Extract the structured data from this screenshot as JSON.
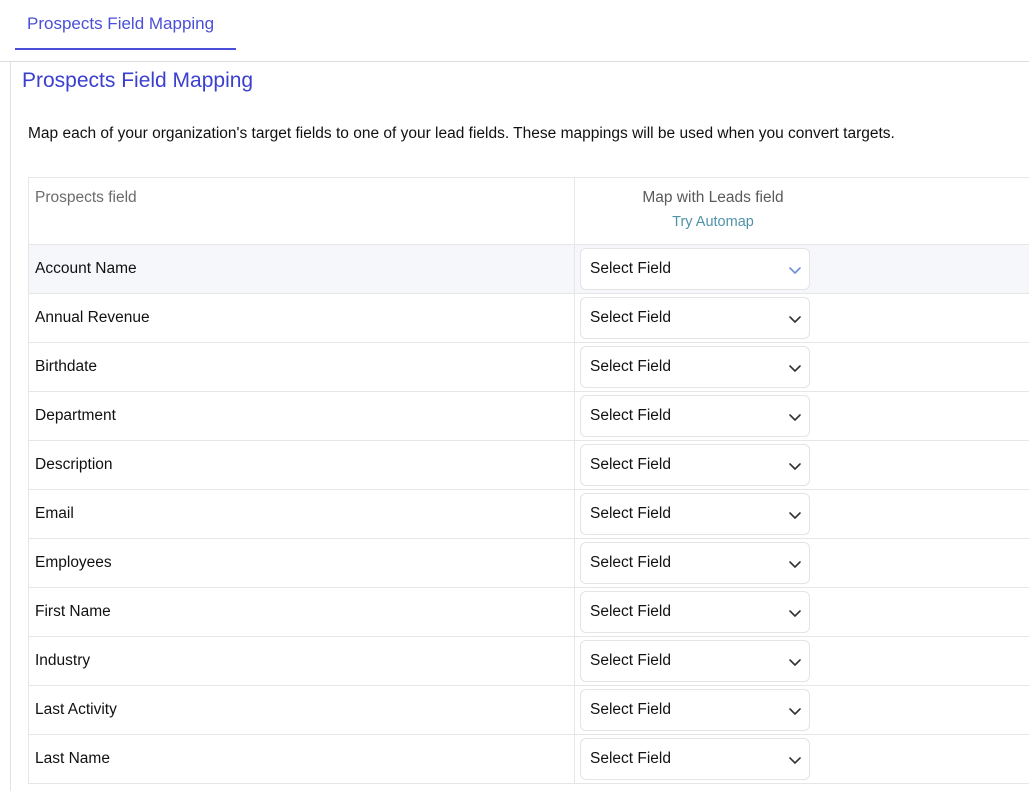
{
  "tabs": [
    {
      "label": "Prospects Field Mapping",
      "active": true
    }
  ],
  "page": {
    "title": "Prospects Field Mapping",
    "description": "Map each of your organization's target fields to one of your lead fields. These mappings will be used when you convert targets."
  },
  "table": {
    "header": {
      "prospects_field": "Prospects field",
      "leads_field": "Map with Leads field",
      "automap": "Try Automap"
    },
    "rows": [
      {
        "field": "Account Name",
        "select": "Select Field"
      },
      {
        "field": "Annual Revenue",
        "select": "Select Field"
      },
      {
        "field": "Birthdate",
        "select": "Select Field"
      },
      {
        "field": "Department",
        "select": "Select Field"
      },
      {
        "field": "Description",
        "select": "Select Field"
      },
      {
        "field": "Email",
        "select": "Select Field"
      },
      {
        "field": "Employees",
        "select": "Select Field"
      },
      {
        "field": "First Name",
        "select": "Select Field"
      },
      {
        "field": "Industry",
        "select": "Select Field"
      },
      {
        "field": "Last Activity",
        "select": "Select Field"
      },
      {
        "field": "Last Name",
        "select": "Select Field"
      }
    ]
  },
  "icons": {
    "dropdown": "chevron-down-icon"
  },
  "colors": {
    "accent": "#4a4fd8",
    "title": "#3b3fce",
    "link": "#4f93a8",
    "active_chevron": "#6f8fd8",
    "chevron": "#333333",
    "highlight_row": "#f6f7fb"
  }
}
